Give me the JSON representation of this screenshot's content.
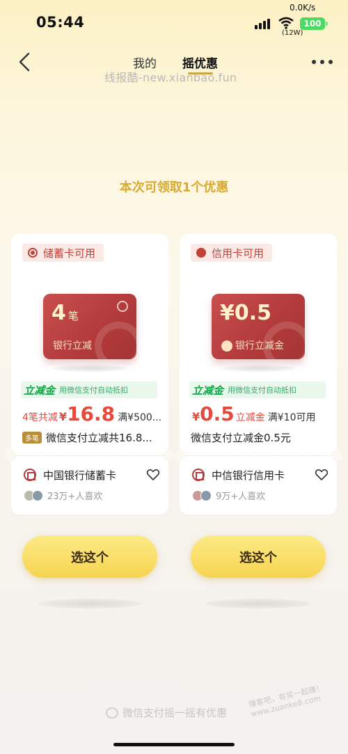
{
  "status_bar": {
    "time": "05:44",
    "net_speed": "0.0K/s",
    "wifi_label": "(12W)",
    "battery": "100"
  },
  "nav": {
    "tab_mine": "我的",
    "tab_shake": "摇优惠"
  },
  "watermark": "线报酷-new.xianbao.fun",
  "offer_count": "本次可领取1个优惠",
  "cards": [
    {
      "tag": "储蓄卡可用",
      "image_big": "4",
      "image_big_unit": "笔",
      "image_label": "银行立减",
      "instant_tag": "立减金",
      "instant_desc": "用微信支付自动抵扣",
      "price_prefix": "4笔共减",
      "price_currency": "¥",
      "price_amount": "16.8",
      "price_suffix": "满¥500...",
      "badge": "多笔",
      "desc": "微信支付立减共16.8...",
      "bank_name": "中国银行储蓄卡",
      "likes": "23万+人喜欢",
      "button": "选这个"
    },
    {
      "tag": "信用卡可用",
      "image_big": "¥0.5",
      "image_label": "银行立减金",
      "instant_tag": "立减金",
      "instant_desc": "用微信支付自动抵扣",
      "price_currency": "¥",
      "price_amount": "0.5",
      "price_unit": "立减金",
      "price_suffix": "满¥10可用",
      "desc": "微信支付立减金0.5元",
      "bank_name": "中信银行信用卡",
      "likes": "9万+人喜欢",
      "button": "选这个"
    }
  ],
  "footer": {
    "brand": "微信支付摇一摇有优惠",
    "site_line1": "赚客吧，有奖一起赚！",
    "site_line2": "www.zuanke8.com"
  },
  "colors": {
    "accent_gold": "#d8aa2e",
    "price_red": "#e54b3d",
    "instant_green": "#13a84a",
    "card_red": "#b23a3a"
  }
}
